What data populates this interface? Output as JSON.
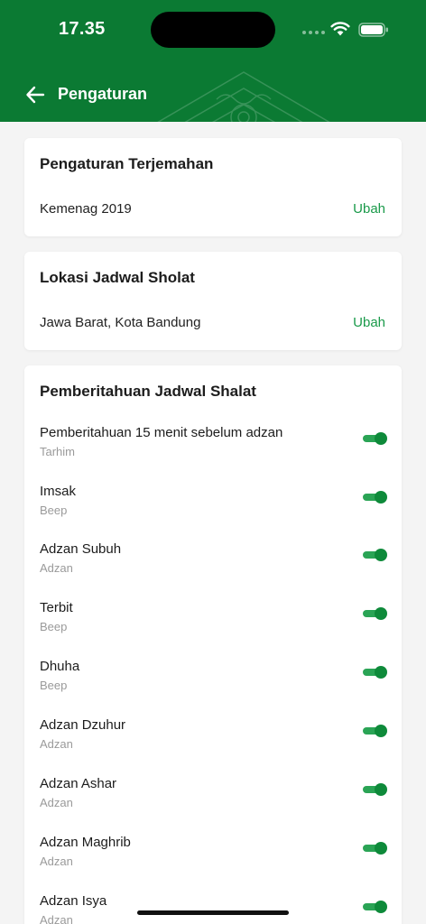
{
  "status_bar": {
    "time": "17.35"
  },
  "header": {
    "title": "Pengaturan"
  },
  "translation": {
    "title": "Pengaturan Terjemahan",
    "value": "Kemenag 2019",
    "action": "Ubah"
  },
  "location": {
    "title": "Lokasi Jadwal Sholat",
    "value": "Jawa Barat, Kota Bandung",
    "action": "Ubah"
  },
  "notifications": {
    "title": "Pemberitahuan Jadwal Shalat",
    "items": [
      {
        "label": "Pemberitahuan 15 menit sebelum adzan",
        "sub": "Tarhim",
        "enabled": true
      },
      {
        "label": "Imsak",
        "sub": "Beep",
        "enabled": true
      },
      {
        "label": "Adzan Subuh",
        "sub": "Adzan",
        "enabled": true
      },
      {
        "label": "Terbit",
        "sub": "Beep",
        "enabled": true
      },
      {
        "label": "Dhuha",
        "sub": "Beep",
        "enabled": true
      },
      {
        "label": "Adzan Dzuhur",
        "sub": "Adzan",
        "enabled": true
      },
      {
        "label": "Adzan Ashar",
        "sub": "Adzan",
        "enabled": true
      },
      {
        "label": "Adzan Maghrib",
        "sub": "Adzan",
        "enabled": true
      },
      {
        "label": "Adzan Isya",
        "sub": "Adzan",
        "enabled": true
      }
    ]
  },
  "colors": {
    "header": "#0b7a33",
    "accent": "#1a9a4a",
    "toggle_on": "#0e8a3a"
  }
}
